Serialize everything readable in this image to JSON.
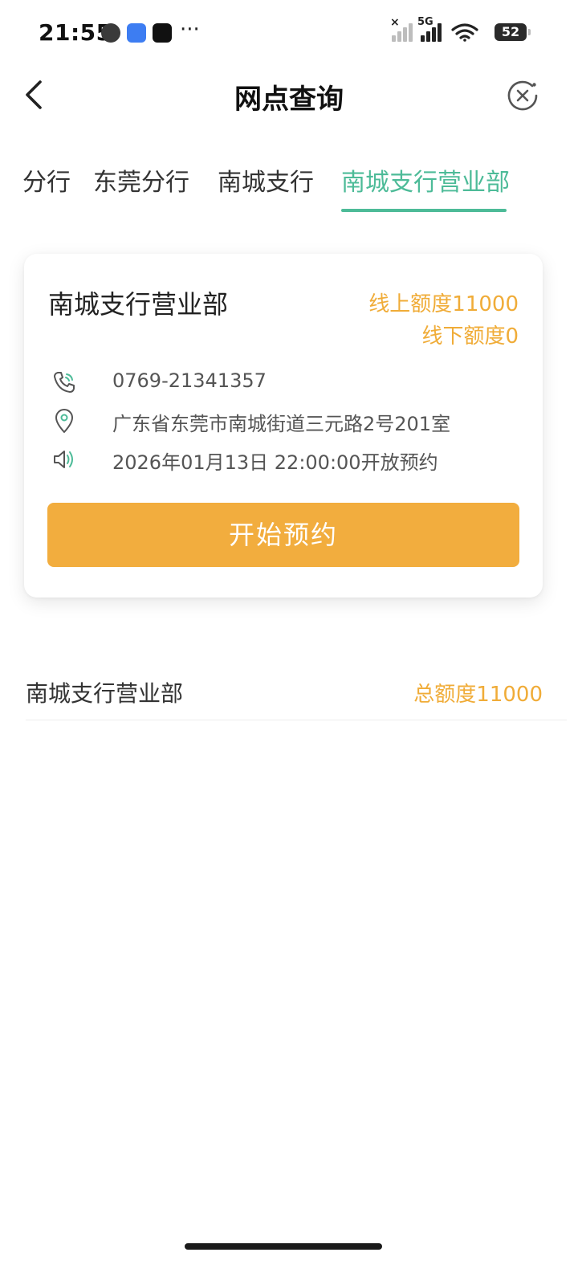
{
  "status_bar": {
    "time": "21:55",
    "more": "···",
    "network": "5G",
    "battery": "52"
  },
  "header": {
    "title": "网点查询",
    "back_icon": "chevron-left-icon",
    "close_icon": "close-circle-icon"
  },
  "tabs": [
    {
      "label": "分行",
      "active": false
    },
    {
      "label": "东莞分行",
      "active": false
    },
    {
      "label": "南城支行",
      "active": false
    },
    {
      "label": "南城支行营业部",
      "active": true
    }
  ],
  "card": {
    "title": "南城支行营业部",
    "online_quota": "线上额度11000",
    "offline_quota": "线下额度0",
    "phone": "0769-21341357",
    "address": "广东省东莞市南城街道三元路2号201室",
    "notice": "2026年01月13日 22:00:00开放预约",
    "button_label": "开始预约"
  },
  "summary": {
    "name": "南城支行营业部",
    "total_quota": "总额度11000"
  },
  "colors": {
    "accent_green": "#4dbb98",
    "accent_orange": "#f2ad3e",
    "quota_text": "#f0ac38"
  }
}
